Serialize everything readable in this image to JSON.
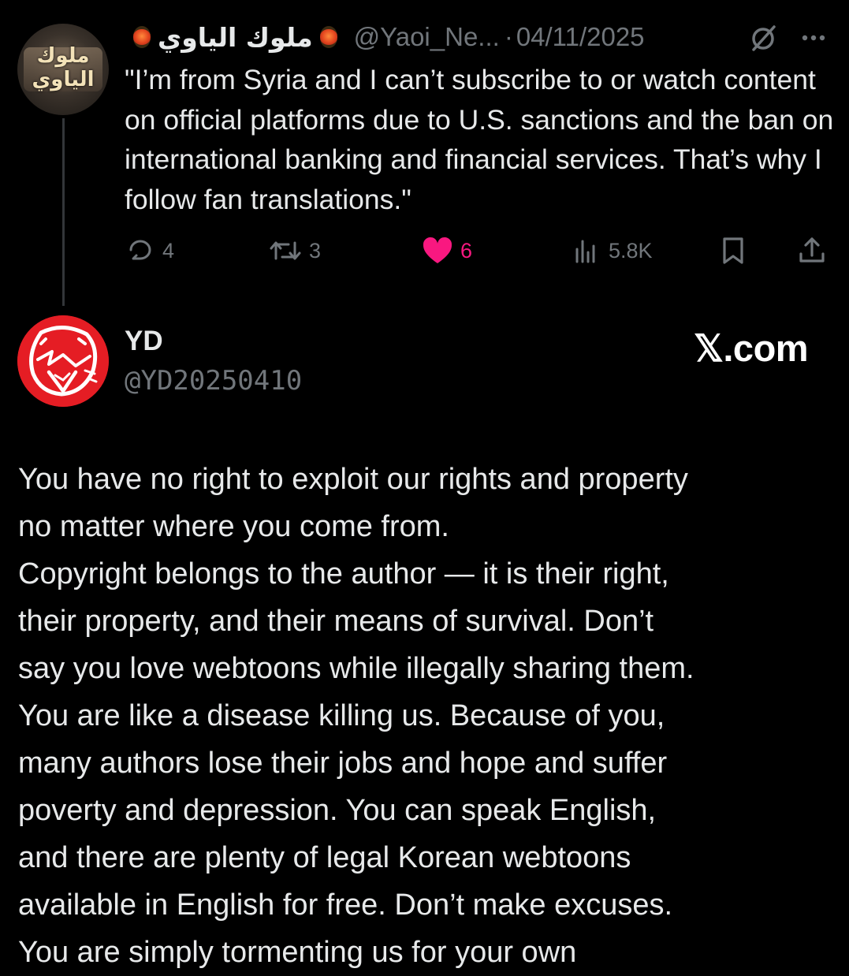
{
  "tweet1": {
    "avatar_text": "ملوك الياوي",
    "display_name": "ملوك الياوي",
    "handle": "@Yaoi_Ne...",
    "separator": "·",
    "date": "04/11/2025",
    "text": "\"I’m from Syria and I can’t subscribe to or watch content on official platforms due to U.S. sanctions and the ban on international banking and financial services. That’s why I follow fan translations.\"",
    "replies": "4",
    "reposts": "3",
    "likes": "6",
    "views": "5.8K",
    "like_color": "#f91880"
  },
  "tweet2": {
    "display_name": "YD",
    "handle": "@YD20250410",
    "brand": "𝕏.com",
    "lines": [
      "You have no right to exploit our rights and property",
      "no matter where you come from.",
      "Copyright belongs to the author — it is their right,",
      "their property, and their means of survival. Don’t",
      "say you love webtoons while illegally sharing them.",
      "You are like a disease killing us. Because of you,",
      "many authors lose their jobs and hope and suffer",
      "poverty and depression. You can speak English,",
      "and there are plenty of legal Korean webtoons",
      "available in English for free. Don’t make excuses.",
      "You are simply tormenting us for your own"
    ],
    "avatar_color": "#e51d24"
  }
}
